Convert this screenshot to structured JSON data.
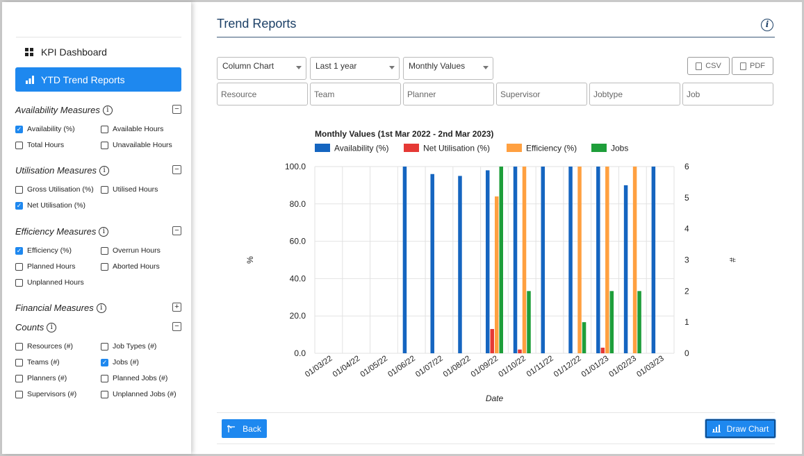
{
  "sidebar": {
    "kpi_dashboard": "KPI Dashboard",
    "ytd_trend_reports": "YTD Trend Reports",
    "sections": {
      "availability": {
        "title": "Availability Measures",
        "toggle": "−",
        "items": {
          "availability_pct": {
            "label": "Availability (%)",
            "checked": true
          },
          "available_hours": {
            "label": "Available Hours",
            "checked": false
          },
          "total_hours": {
            "label": "Total Hours",
            "checked": false
          },
          "unavailable_hours": {
            "label": "Unavailable Hours",
            "checked": false
          }
        }
      },
      "utilisation": {
        "title": "Utilisation Measures",
        "toggle": "−",
        "items": {
          "gross_utilisation": {
            "label": "Gross Utilisation (%)",
            "checked": false
          },
          "utilised_hours": {
            "label": "Utilised Hours",
            "checked": false
          },
          "net_utilisation": {
            "label": "Net Utilisation (%)",
            "checked": true
          }
        }
      },
      "efficiency": {
        "title": "Efficiency Measures",
        "toggle": "−",
        "items": {
          "efficiency_pct": {
            "label": "Efficiency (%)",
            "checked": true
          },
          "overrun_hours": {
            "label": "Overrun Hours",
            "checked": false
          },
          "planned_hours": {
            "label": "Planned Hours",
            "checked": false
          },
          "aborted_hours": {
            "label": "Aborted Hours",
            "checked": false
          },
          "unplanned_hours": {
            "label": "Unplanned Hours",
            "checked": false
          }
        }
      },
      "financial": {
        "title": "Financial Measures",
        "toggle": "+"
      },
      "counts": {
        "title": "Counts",
        "toggle": "−",
        "items": {
          "resources": {
            "label": "Resources (#)",
            "checked": false
          },
          "job_types": {
            "label": "Job Types (#)",
            "checked": false
          },
          "teams": {
            "label": "Teams (#)",
            "checked": false
          },
          "jobs": {
            "label": "Jobs (#)",
            "checked": true
          },
          "planners": {
            "label": "Planners (#)",
            "checked": false
          },
          "planned_jobs": {
            "label": "Planned Jobs (#)",
            "checked": false
          },
          "supervisors": {
            "label": "Supervisors (#)",
            "checked": false
          },
          "unplanned_jobs": {
            "label": "Unplanned Jobs (#)",
            "checked": false
          }
        }
      }
    }
  },
  "main": {
    "title": "Trend Reports",
    "help_icon": "i",
    "selects": {
      "chart_type": "Column Chart",
      "period": "Last 1 year",
      "values": "Monthly Values"
    },
    "export": {
      "csv": "CSV",
      "pdf": "PDF"
    },
    "filters": {
      "resource": "Resource",
      "team": "Team",
      "planner": "Planner",
      "supervisor": "Supervisor",
      "jobtype": "Jobtype",
      "job": "Job"
    },
    "back_button": "Back",
    "draw_chart_button": "Draw Chart"
  },
  "colors": {
    "accent": "#1e88ef",
    "availability": "#1565c0",
    "net_utilisation": "#e53935",
    "efficiency": "#ffa040",
    "jobs": "#1e9e3a"
  },
  "chart_data": {
    "type": "bar",
    "title": "Monthly Values (1st Mar 2022 - 2nd Mar 2023)",
    "xlabel": "Date",
    "ylabel": "%",
    "y2label": "#",
    "ylim": [
      0,
      100
    ],
    "y2lim": [
      0,
      6
    ],
    "yticks": [
      "0.0",
      "20.0",
      "40.0",
      "60.0",
      "80.0",
      "100.0"
    ],
    "y2ticks": [
      "0",
      "1",
      "2",
      "3",
      "4",
      "5",
      "6"
    ],
    "legend_position": "top",
    "grid": true,
    "categories": [
      "01/03/22",
      "01/04/22",
      "01/05/22",
      "01/06/22",
      "01/07/22",
      "01/08/22",
      "01/09/22",
      "01/10/22",
      "01/11/22",
      "01/12/22",
      "01/01/23",
      "01/02/23",
      "01/03/23"
    ],
    "series": [
      {
        "name": "Availability (%)",
        "axis": "left",
        "color": "#1565c0",
        "values": [
          0,
          0,
          0,
          100,
          96,
          95,
          98,
          100,
          100,
          100,
          100,
          90,
          100
        ]
      },
      {
        "name": "Net Utilisation (%)",
        "axis": "left",
        "color": "#e53935",
        "values": [
          0,
          0,
          0,
          0,
          0,
          0,
          13,
          2,
          0,
          0,
          3,
          0,
          0
        ]
      },
      {
        "name": "Efficiency (%)",
        "axis": "left",
        "color": "#ffa040",
        "values": [
          0,
          0,
          0,
          0,
          0,
          0,
          84,
          100,
          0,
          100,
          100,
          100,
          0
        ]
      },
      {
        "name": "Jobs",
        "axis": "right",
        "color": "#1e9e3a",
        "values": [
          0,
          0,
          0,
          0,
          0,
          0,
          6,
          2,
          0,
          1,
          2,
          2,
          0
        ]
      }
    ]
  }
}
